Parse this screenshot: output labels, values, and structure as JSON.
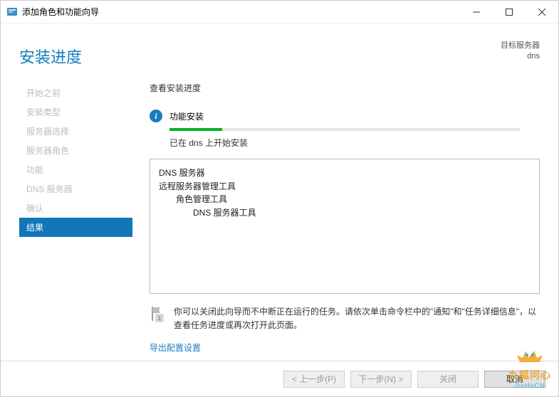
{
  "window": {
    "title": "添加角色和功能向导"
  },
  "header": {
    "heading": "安装进度",
    "target_label": "目标服务器",
    "target_name": "dns"
  },
  "sidebar": {
    "items": [
      {
        "label": "开始之前"
      },
      {
        "label": "安装类型"
      },
      {
        "label": "服务器选择"
      },
      {
        "label": "服务器角色"
      },
      {
        "label": "功能"
      },
      {
        "label": "DNS 服务器"
      },
      {
        "label": "确认"
      },
      {
        "label": "结果"
      }
    ],
    "active_index": 7
  },
  "content": {
    "section_label": "查看安装进度",
    "status_title": "功能安装",
    "progress_message": "已在 dns 上开始安装",
    "features": {
      "l0a": "DNS 服务器",
      "l0b": "远程服务器管理工具",
      "l1a": "角色管理工具",
      "l2a": "DNS 服务器工具"
    },
    "note_text": "你可以关闭此向导而不中断正在运行的任务。请依次单击命令栏中的\"通知\"和\"任务详细信息\"，以查看任务进度或再次打开此页面。",
    "export_link": "导出配置设置"
  },
  "footer": {
    "prev": "< 上一步(P)",
    "next": "下一步(N) >",
    "close": "关闭",
    "cancel": "取消"
  },
  "watermark": {
    "cn": "九狐问心",
    "en": "JiuHuCN"
  }
}
